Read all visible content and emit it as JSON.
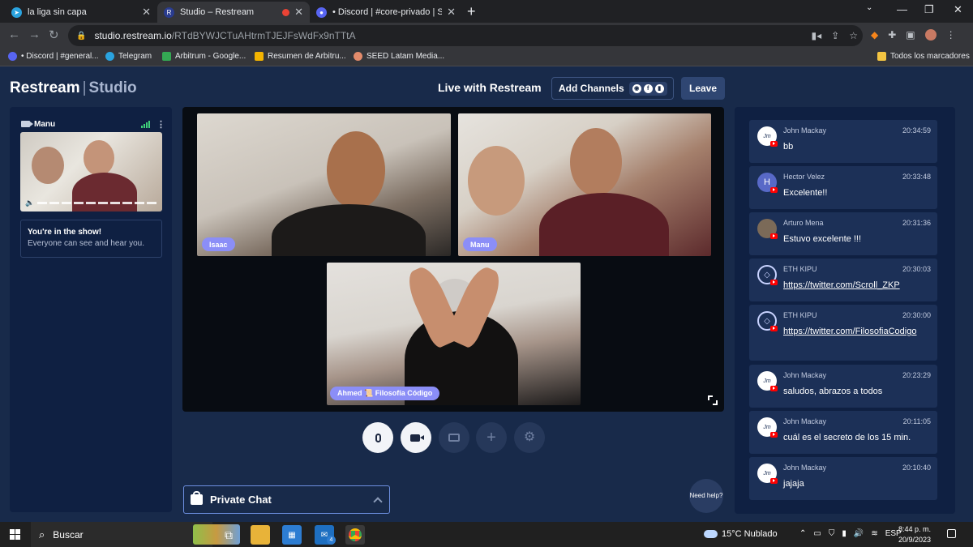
{
  "browser": {
    "tabs": [
      {
        "title": "la liga sin capa",
        "icon": "telegram-icon",
        "color": "#2aa3df"
      },
      {
        "title": "Studio – Restream",
        "icon": "restream-icon",
        "color": "#2a3c8f"
      },
      {
        "title": "• Discord | #core-privado | SEED L",
        "icon": "discord-icon",
        "color": "#5865f2"
      }
    ],
    "url_host": "studio.restream.io",
    "url_path": "/RTdBYWJCTuAHtrmTJEJFsWdFx9nTTtA",
    "bookmarks": [
      {
        "label": "• Discord | #general...",
        "color": "#5865f2"
      },
      {
        "label": "Telegram",
        "color": "#2aa3df"
      },
      {
        "label": "Arbitrum - Google...",
        "color": "#34a853"
      },
      {
        "label": "Resumen de Arbitru...",
        "color": "#f4b400"
      },
      {
        "label": "SEED Latam Media...",
        "color": "#e38b6b"
      }
    ],
    "all_bookmarks": "Todos los marcadores"
  },
  "studio": {
    "brand_main": "Restream",
    "brand_sep": "|",
    "brand_sub": "Studio",
    "live_title": "Live with Restream",
    "add_channels": "Add Channels",
    "leave": "Leave",
    "self_view": {
      "name": "Manu",
      "status_title": "You're in the show!",
      "status_sub": "Everyone can see and hear you."
    },
    "participants": [
      {
        "name": "Isaac"
      },
      {
        "name": "Manu"
      },
      {
        "name": "Ahmed 📜 Filosofía Código"
      }
    ],
    "private_chat": "Private Chat",
    "need_help": "Need help?"
  },
  "chat": [
    {
      "author": "John Mackay",
      "time": "20:34:59",
      "text": "bb",
      "avatar": "signature",
      "link": false
    },
    {
      "author": "Hector Velez",
      "time": "20:33:48",
      "text": "Excelente!!",
      "avatar": "H",
      "link": false
    },
    {
      "author": "Arturo Mena",
      "time": "20:31:36",
      "text": "Estuvo excelente !!!",
      "avatar": "photo",
      "link": false
    },
    {
      "author": "ETH KIPU",
      "time": "20:30:03",
      "text": "https://twitter.com/Scroll_ZKP",
      "avatar": "eth",
      "link": true
    },
    {
      "author": "ETH KIPU",
      "time": "20:30:00",
      "text": "https://twitter.com/FilosofiaCodigo",
      "avatar": "eth",
      "link": true
    },
    {
      "author": "John Mackay",
      "time": "20:23:29",
      "text": "saludos, abrazos a todos",
      "avatar": "signature",
      "link": false
    },
    {
      "author": "John Mackay",
      "time": "20:11:05",
      "text": "cuál es el secreto de los 15 min.",
      "avatar": "signature",
      "link": false
    },
    {
      "author": "John Mackay",
      "time": "20:10:40",
      "text": "jajaja",
      "avatar": "signature",
      "link": false
    }
  ],
  "taskbar": {
    "search": "Buscar",
    "mail_badge": "4",
    "weather": "15°C Nublado",
    "lang": "ESP",
    "time": "8:44 p. m.",
    "date": "20/9/2023"
  }
}
